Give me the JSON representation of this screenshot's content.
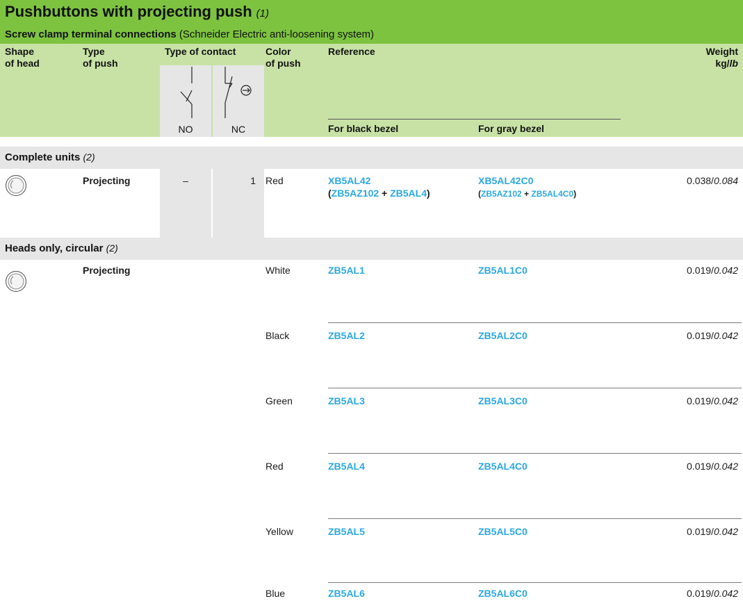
{
  "title": {
    "main": "Pushbuttons with projecting push",
    "note": "(1)"
  },
  "subtitle": {
    "bold": "Screw clamp terminal connections",
    "rest": " (Schneider Electric anti-loosening system)"
  },
  "headers": {
    "shape_l1": "Shape",
    "shape_l2": "of head",
    "type_l1": "Type",
    "type_l2": "of push",
    "contact": "Type of contact",
    "color_l1": "Color",
    "color_l2": "of push",
    "reference": "Reference",
    "weight_l1": "Weight",
    "weight_kg": "kg/",
    "weight_lb": "lb",
    "no": "NO",
    "nc": "NC",
    "black_bezel": "For black bezel",
    "gray_bezel": "For gray bezel"
  },
  "sections": [
    {
      "title": "Complete units",
      "note": "(2)"
    },
    {
      "title": "Heads only, circular",
      "note": "(2)"
    }
  ],
  "complete_unit": {
    "type": "Projecting",
    "no": "–",
    "nc": "1",
    "color": "Red",
    "black_ref": "XB5AL42",
    "black_sub_a": "ZB5AZ102",
    "black_sub_b": "ZB5AL4",
    "gray_ref": "XB5AL42C0",
    "gray_sub_a": "ZB5AZ102",
    "gray_sub_b": "ZB5AL4C0",
    "weight_kg": "0.038/",
    "weight_lb": "0.084"
  },
  "heads": {
    "type": "Projecting",
    "rows": [
      {
        "color": "White",
        "black_ref": "ZB5AL1",
        "gray_ref": "ZB5AL1C0",
        "weight_kg": "0.019/",
        "weight_lb": "0.042"
      },
      {
        "color": "Black",
        "black_ref": "ZB5AL2",
        "gray_ref": "ZB5AL2C0",
        "weight_kg": "0.019/",
        "weight_lb": "0.042"
      },
      {
        "color": "Green",
        "black_ref": "ZB5AL3",
        "gray_ref": "ZB5AL3C0",
        "weight_kg": "0.019/",
        "weight_lb": "0.042"
      },
      {
        "color": "Red",
        "black_ref": "ZB5AL4",
        "gray_ref": "ZB5AL4C0",
        "weight_kg": "0.019/",
        "weight_lb": "0.042"
      },
      {
        "color": "Yellow",
        "black_ref": "ZB5AL5",
        "gray_ref": "ZB5AL5C0",
        "weight_kg": "0.019/",
        "weight_lb": "0.042"
      },
      {
        "color": "Blue",
        "black_ref": "ZB5AL6",
        "gray_ref": "ZB5AL6C0",
        "weight_kg": "0.019/",
        "weight_lb": "0.042"
      }
    ]
  }
}
